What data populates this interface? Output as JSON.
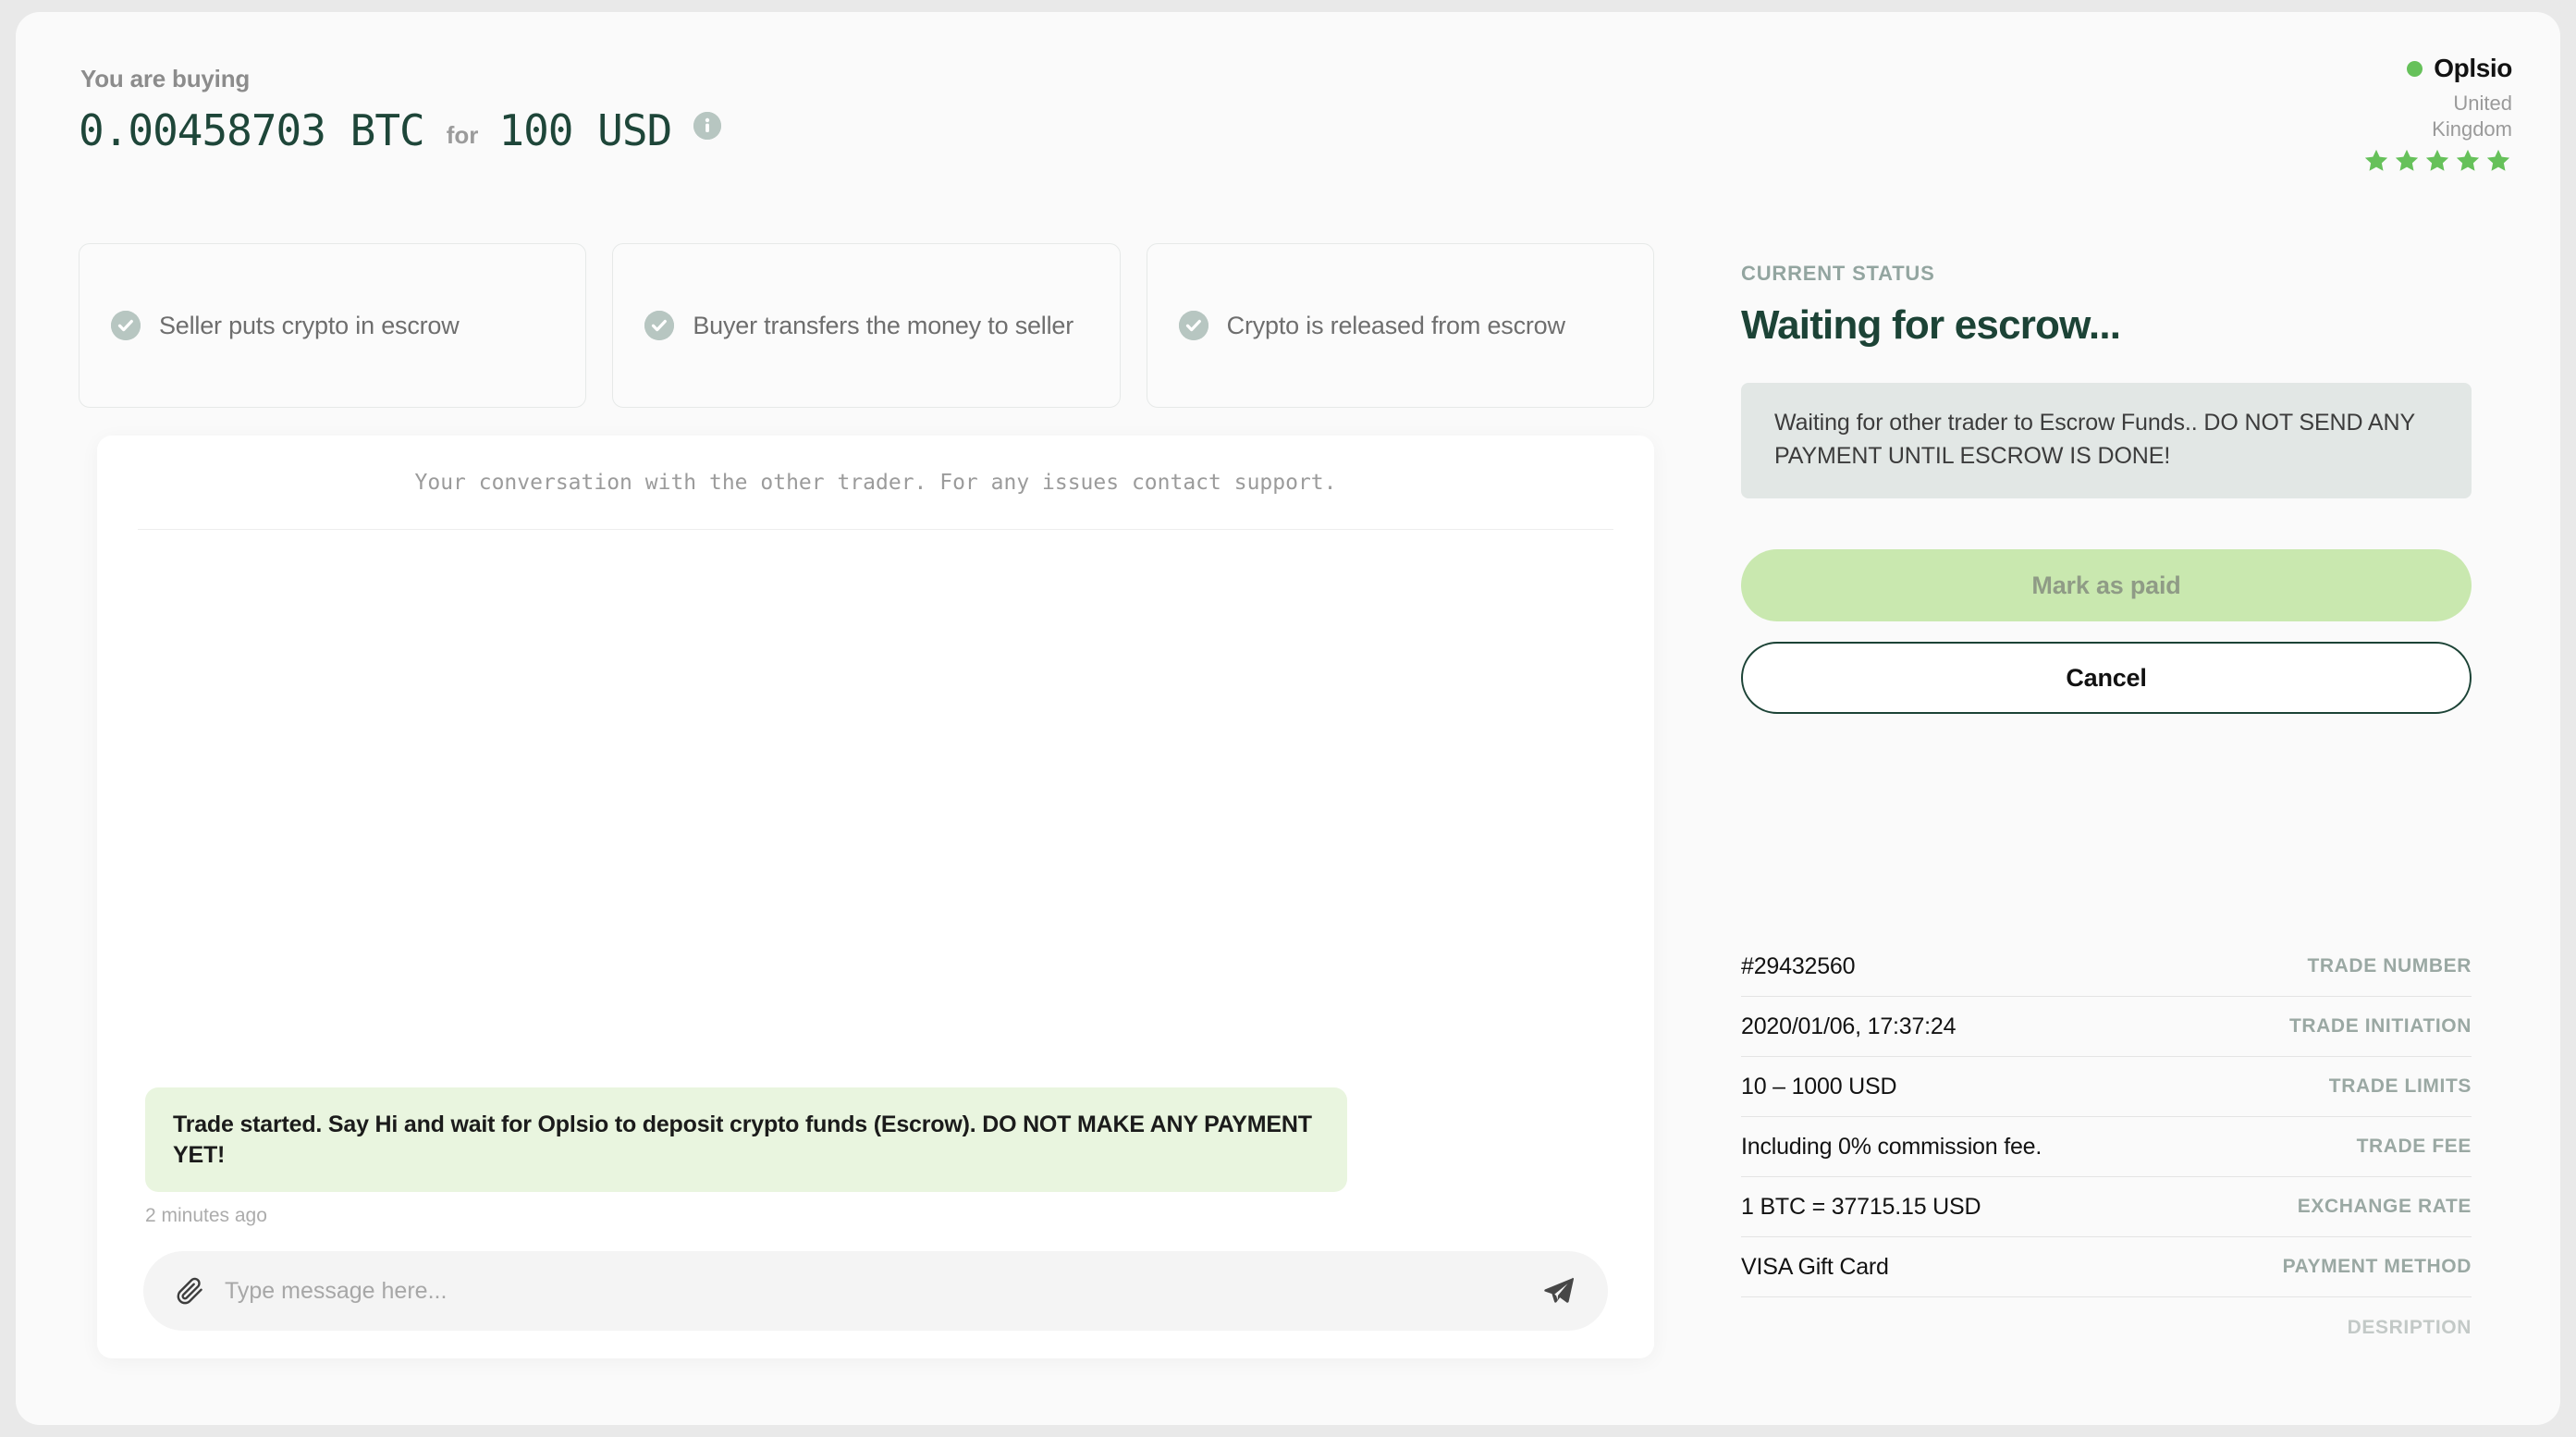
{
  "header": {
    "subtitle": "You are buying",
    "crypto_amount": "0.00458703 BTC",
    "for_label": "for",
    "fiat_amount": "100 USD",
    "info_icon": "info-icon"
  },
  "brand": {
    "name": "Oplsio",
    "online_dot_color": "#66c15a",
    "country": "United Kingdom",
    "rating": 5,
    "star_color": "#66c15a"
  },
  "steps": [
    {
      "label": "Seller puts crypto in escrow",
      "icon": "check-circle-icon",
      "done": true
    },
    {
      "label": "Buyer transfers the money to seller",
      "icon": "check-circle-icon",
      "done": true
    },
    {
      "label": "Crypto is released from escrow",
      "icon": "check-circle-icon",
      "done": true
    }
  ],
  "chat": {
    "header_note": "Your conversation with the other trader. For any issues contact support.",
    "messages": [
      {
        "text": "Trade started. Say Hi and wait for Oplsio to deposit crypto funds (Escrow). DO NOT MAKE ANY PAYMENT YET!",
        "time": "2 minutes ago",
        "bubble_color": "#e9f5df"
      }
    ],
    "input_placeholder": "Type message here...",
    "input_value": "",
    "attach_icon": "paperclip-icon",
    "send_icon": "send-icon"
  },
  "status": {
    "label": "CURRENT STATUS",
    "title": "Waiting for escrow...",
    "notice": "Waiting for other trader to Escrow Funds.. DO NOT SEND ANY PAYMENT UNTIL ESCROW IS DONE!",
    "notice_bg": "#e2e7e5",
    "title_color": "#1c4336"
  },
  "actions": {
    "primary_label": "Mark as paid",
    "primary_disabled": true,
    "primary_bg": "#c9e8af",
    "secondary_label": "Cancel"
  },
  "details": [
    {
      "value": "#29432560",
      "key": "TRADE NUMBER"
    },
    {
      "value": "2020/01/06, 17:37:24",
      "key": "TRADE INITIATION"
    },
    {
      "value": "10 – 1000 USD",
      "key": "TRADE LIMITS"
    },
    {
      "value": "Including 0% commission fee.",
      "key": "TRADE FEE"
    },
    {
      "value": "1 BTC = 37715.15 USD",
      "key": "EXCHANGE RATE"
    },
    {
      "value": "VISA Gift Card",
      "key": "PAYMENT METHOD"
    },
    {
      "value": "",
      "key": "DESRIPTION"
    }
  ]
}
